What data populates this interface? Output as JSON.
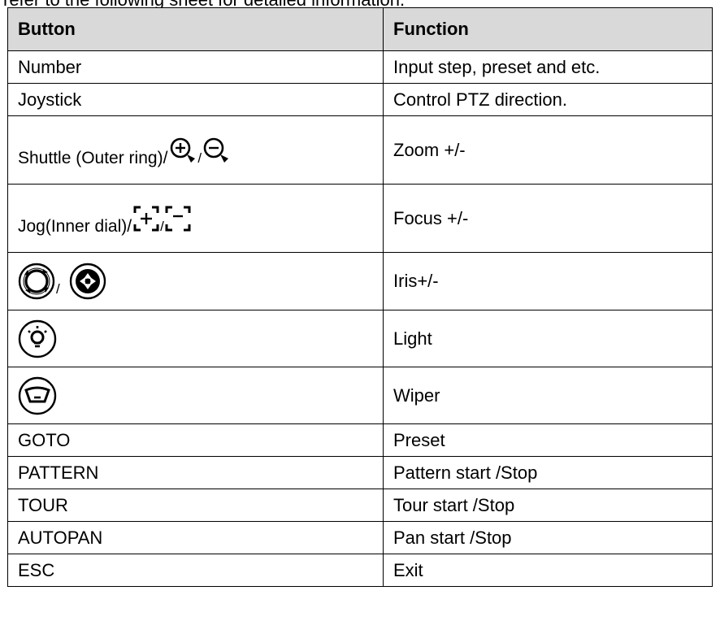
{
  "intro_text": "refer to the following sheet for detailed information.",
  "table": {
    "headers": [
      "Button",
      "Function"
    ],
    "rows": [
      {
        "button": "Number",
        "function": "Input step, preset and etc."
      },
      {
        "button": "Joystick",
        "function": "Control PTZ direction."
      },
      {
        "button": "Shuttle (Outer ring)/",
        "icons": [
          "zoom-in-icon",
          "zoom-out-icon"
        ],
        "separator": "/",
        "function": "Zoom +/-"
      },
      {
        "button": "Jog(Inner dial)/",
        "icons": [
          "focus-near-icon",
          "focus-far-icon"
        ],
        "separator": "/",
        "function": "Focus +/-"
      },
      {
        "button": "",
        "icons": [
          "iris-open-icon",
          "iris-close-icon"
        ],
        "separator": "/",
        "function": "Iris+/-"
      },
      {
        "button": "",
        "icons": [
          "light-bulb-icon"
        ],
        "function": "Light"
      },
      {
        "button": "",
        "icons": [
          "wiper-icon"
        ],
        "function": "Wiper"
      },
      {
        "button": "GOTO",
        "function": "Preset"
      },
      {
        "button": "PATTERN",
        "function": "Pattern start /Stop"
      },
      {
        "button": "TOUR",
        "function": "Tour start /Stop"
      },
      {
        "button": "AUTOPAN",
        "function": "Pan start /Stop"
      },
      {
        "button": "ESC",
        "function": "Exit"
      }
    ]
  }
}
